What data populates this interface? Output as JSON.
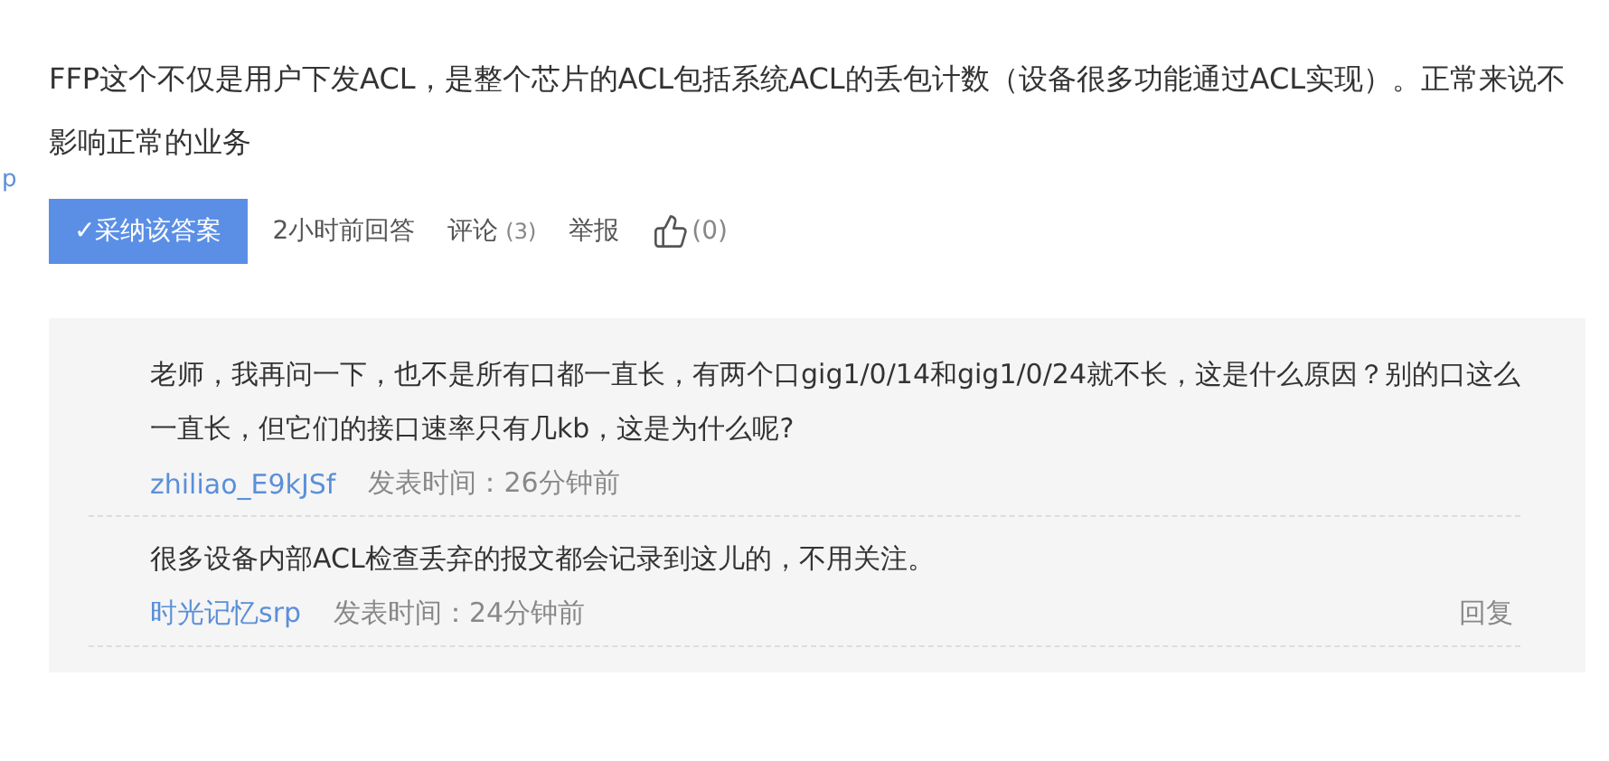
{
  "side_link": "p",
  "answer": {
    "text": "FFP这个不仅是用户下发ACL，是整个芯片的ACL包括系统ACL的丢包计数（设备很多功能通过ACL实现）。正常来说不影响正常的业务",
    "accept_button": "✓采纳该答案",
    "time": "2小时前回答",
    "comment_label": "评论",
    "comment_count": "(3)",
    "report": "举报",
    "like_count": "(0)"
  },
  "comments": [
    {
      "text": "老师，我再问一下，也不是所有口都一直长，有两个口gig1/0/14和gig1/0/24就不长，这是什么原因？别的口这么一直长，但它们的接口速率只有几kb，这是为什么呢?",
      "author": "zhiliao_E9kJSf",
      "time": "发表时间：26分钟前"
    },
    {
      "text": "很多设备内部ACL检查丢弃的报文都会记录到这儿的，不用关注。",
      "author": "时光记忆srp",
      "time": "发表时间：24分钟前",
      "reply": "回复"
    }
  ]
}
